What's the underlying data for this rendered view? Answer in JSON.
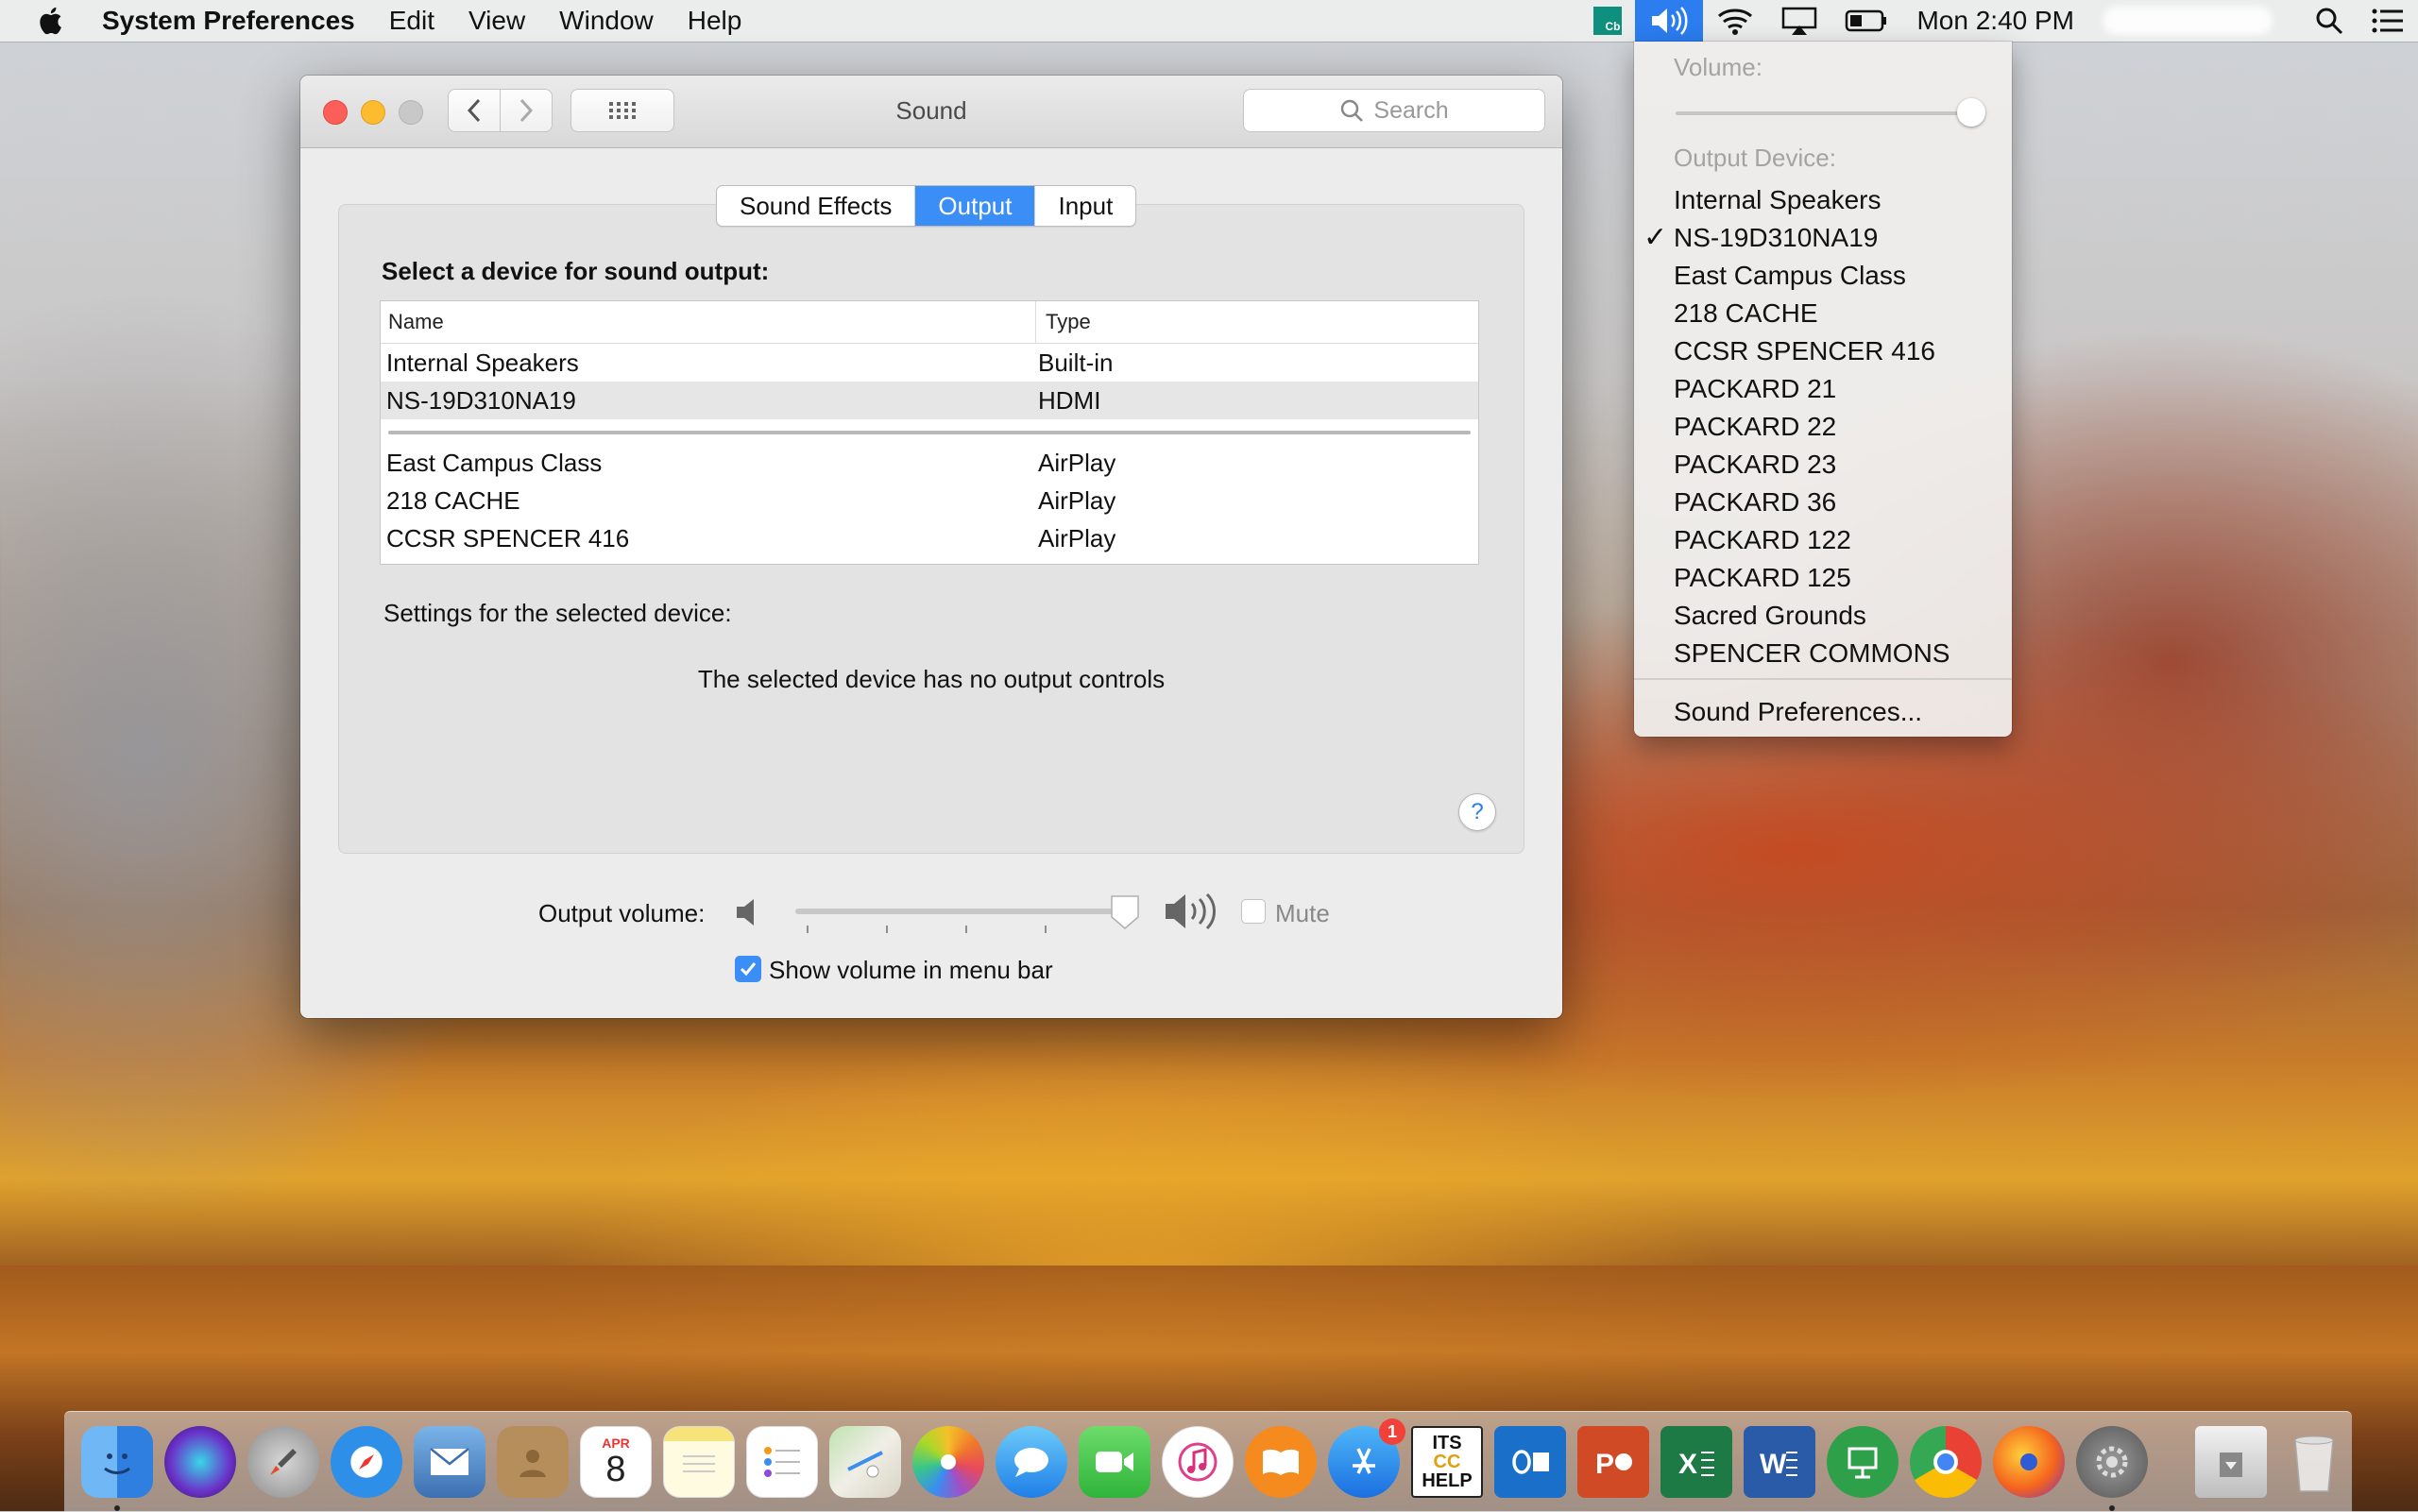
{
  "menubar": {
    "app_name": "System Preferences",
    "items": [
      "Edit",
      "View",
      "Window",
      "Help"
    ],
    "cb_badge": "Cb",
    "clock": "Mon 2:40 PM"
  },
  "window": {
    "title": "Sound",
    "search_placeholder": "Search",
    "tabs": [
      "Sound Effects",
      "Output",
      "Input"
    ],
    "selected_tab": "Output",
    "heading": "Select a device for sound output:",
    "columns": {
      "name": "Name",
      "type": "Type"
    },
    "devices_local": [
      {
        "name": "Internal Speakers",
        "type": "Built-in"
      },
      {
        "name": "NS-19D310NA19",
        "type": "HDMI"
      }
    ],
    "devices_airplay": [
      {
        "name": "East Campus Class",
        "type": "AirPlay"
      },
      {
        "name": "218 CACHE",
        "type": "AirPlay"
      },
      {
        "name": "CCSR SPENCER 416",
        "type": "AirPlay"
      }
    ],
    "selected_device": "NS-19D310NA19",
    "settings_label": "Settings for the selected device:",
    "no_controls": "The selected device has no output controls",
    "help": "?",
    "output_volume_label": "Output volume:",
    "output_volume_fraction": 0.93,
    "mute_label": "Mute",
    "mute_checked": false,
    "show_volume_label": "Show volume in menu bar",
    "show_volume_checked": true
  },
  "dropdown": {
    "volume_label": "Volume:",
    "volume_fraction": 1.0,
    "output_device_label": "Output Device:",
    "devices": [
      "Internal Speakers",
      "NS-19D310NA19",
      "East Campus Class",
      "218 CACHE",
      "CCSR SPENCER 416",
      "PACKARD 21",
      "PACKARD 22",
      "PACKARD 23",
      "PACKARD 36",
      "PACKARD 122",
      "PACKARD 125",
      "Sacred Grounds",
      "SPENCER COMMONS"
    ],
    "checked_device": "NS-19D310NA19",
    "check_mark": "✓",
    "prefs_label": "Sound Preferences..."
  },
  "dock": {
    "calendar": {
      "month": "APR",
      "day": "8"
    },
    "app_store_badge": "1",
    "its_label": [
      "ITS",
      "CC",
      "HELP"
    ],
    "icons": [
      "finder-icon",
      "siri-icon",
      "launchpad-icon",
      "safari-icon",
      "mail-icon",
      "contacts-icon",
      "calendar-icon",
      "notes-icon",
      "reminders-icon",
      "maps-icon",
      "photos-icon",
      "messages-icon",
      "facetime-icon",
      "itunes-icon",
      "ibooks-icon",
      "app-store-icon",
      "its-help-icon",
      "outlook-icon",
      "powerpoint-icon",
      "excel-icon",
      "word-icon",
      "keynote-icon",
      "chrome-icon",
      "firefox-icon",
      "system-preferences-icon",
      "downloads-icon",
      "trash-icon"
    ],
    "colors": {
      "accent": "#3b8ef5",
      "close": "#fc5f57",
      "minimize": "#fdbc2e"
    }
  }
}
